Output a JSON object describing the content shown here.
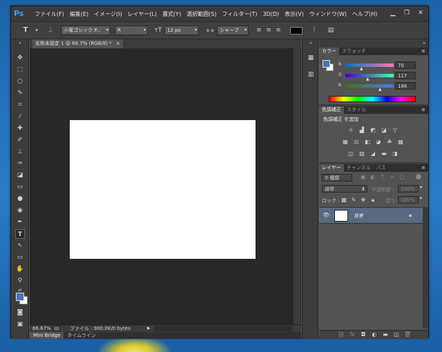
{
  "menu": {
    "app_icon": "Ps",
    "items": [
      "ファイル(F)",
      "編集(E)",
      "イメージ(I)",
      "レイヤー(L)",
      "書式(Y)",
      "選択範囲(S)",
      "フィルター(T)",
      "3D(D)",
      "表示(V)",
      "ウィンドウ(W)",
      "ヘルプ(H)"
    ]
  },
  "options_bar": {
    "font_family": "小塚ゴシック P...",
    "font_style": "R",
    "font_size": "12 px",
    "antialias_label": "a a",
    "antialias": "シャープ"
  },
  "document": {
    "tab_title": "名称未設定 1 @ 66.7% (RGB/8) *",
    "tab_close": "×"
  },
  "status": {
    "zoom": "66.67%",
    "file_info": "ファイル : 900.0K/0 bytes"
  },
  "bottom_tabs": [
    "Mini Bridge",
    "タイムライン"
  ],
  "color_panel": {
    "tabs": [
      "カラー",
      "スウォッチ"
    ],
    "r_label": "R",
    "g_label": "G",
    "b_label": "B",
    "r": "70",
    "g": "117",
    "b": "186",
    "fg_color": "#4675ba"
  },
  "adjust_panel": {
    "tabs": [
      "色調補正",
      "スタイル"
    ],
    "add_label": "色調補正 を追加"
  },
  "layers_panel": {
    "tabs": [
      "レイヤー",
      "チャンネル",
      "パス"
    ],
    "filter_label": "種類",
    "blend_mode": "通常",
    "opacity_label": "不透明度 :",
    "opacity": "100%",
    "lock_label": "ロック :",
    "fill_label": "塗り :",
    "fill": "100%",
    "layer_name": "背景"
  }
}
